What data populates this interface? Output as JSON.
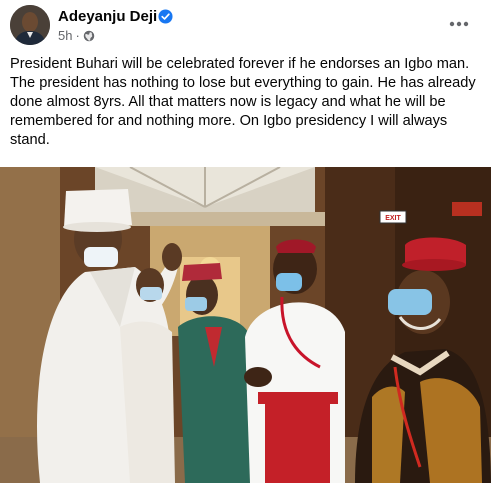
{
  "post": {
    "author": "Adeyanju Deji",
    "time": "5h",
    "separator": "·",
    "privacy_icon": "globe-icon",
    "verified_icon": "verified-badge-icon",
    "menu_icon": "more-options-icon",
    "text": "President Buhari will be celebrated forever if he endorses an Igbo man. The president has nothing to lose but everything to gain. He has already done almost 8yrs. All that matters now is legacy and what he will be remembered for and nothing more. On Igbo presidency I will always stand."
  },
  "photo": {
    "sign_text": "EXIT"
  },
  "colors": {
    "verified": "#1877f2",
    "meta_text": "#65676b",
    "text": "#050505"
  }
}
